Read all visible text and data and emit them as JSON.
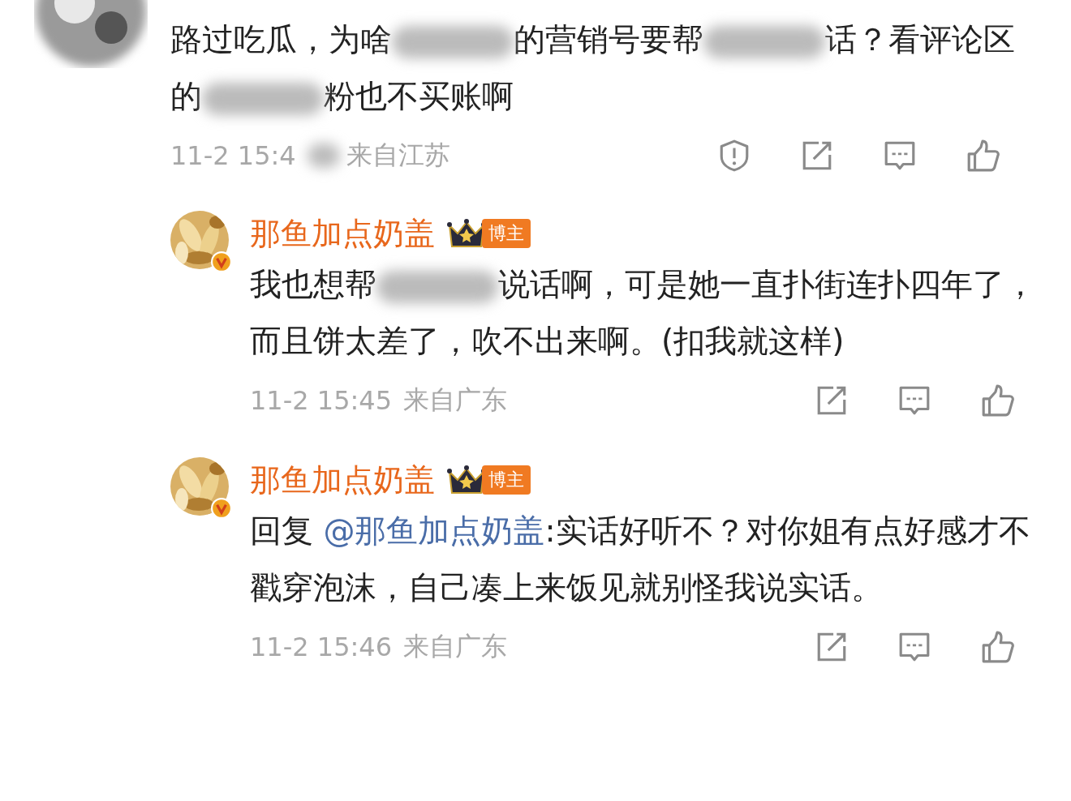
{
  "comments": [
    {
      "kind": "top",
      "segments": [
        {
          "kind": "text",
          "text": "路过吃瓜，为啥"
        },
        {
          "kind": "blur"
        },
        {
          "kind": "text",
          "text": "的营销号要帮"
        },
        {
          "kind": "blur"
        },
        {
          "kind": "text",
          "text": "话？看评论区的"
        },
        {
          "kind": "blur"
        },
        {
          "kind": "text",
          "text": "粉也不买账啊"
        }
      ],
      "time": "11-2 15:4",
      "time_blurred": true,
      "location": "来自江苏",
      "actions": [
        {
          "kind": "report"
        },
        {
          "kind": "share"
        },
        {
          "kind": "comment"
        },
        {
          "kind": "like"
        }
      ]
    },
    {
      "kind": "reply",
      "author": "那鱼加点奶盖",
      "verified": true,
      "badge": "博主",
      "segments": [
        {
          "kind": "text",
          "text": "我也想帮"
        },
        {
          "kind": "blur"
        },
        {
          "kind": "text",
          "text": "说话啊，可是她一直扑街连扑四年了，而且饼太差了，吹不出来啊。(扣我就这样)"
        }
      ],
      "time": "11-2 15:45",
      "time_blurred": false,
      "location": "来自广东",
      "actions": [
        {
          "kind": "share"
        },
        {
          "kind": "comment"
        },
        {
          "kind": "like"
        }
      ]
    },
    {
      "kind": "reply",
      "author": "那鱼加点奶盖",
      "verified": true,
      "badge": "博主",
      "segments": [
        {
          "kind": "text",
          "text": "回复 "
        },
        {
          "kind": "mention",
          "text": "@那鱼加点奶盖"
        },
        {
          "kind": "text",
          "text": ":实话好听不？对你姐有点好感才不戳穿泡沫，自己凑上来饭见就别怪我说实话。"
        }
      ],
      "time": "11-2 15:46",
      "time_blurred": false,
      "location": "来自广东",
      "actions": [
        {
          "kind": "share"
        },
        {
          "kind": "comment"
        },
        {
          "kind": "like"
        }
      ]
    }
  ]
}
